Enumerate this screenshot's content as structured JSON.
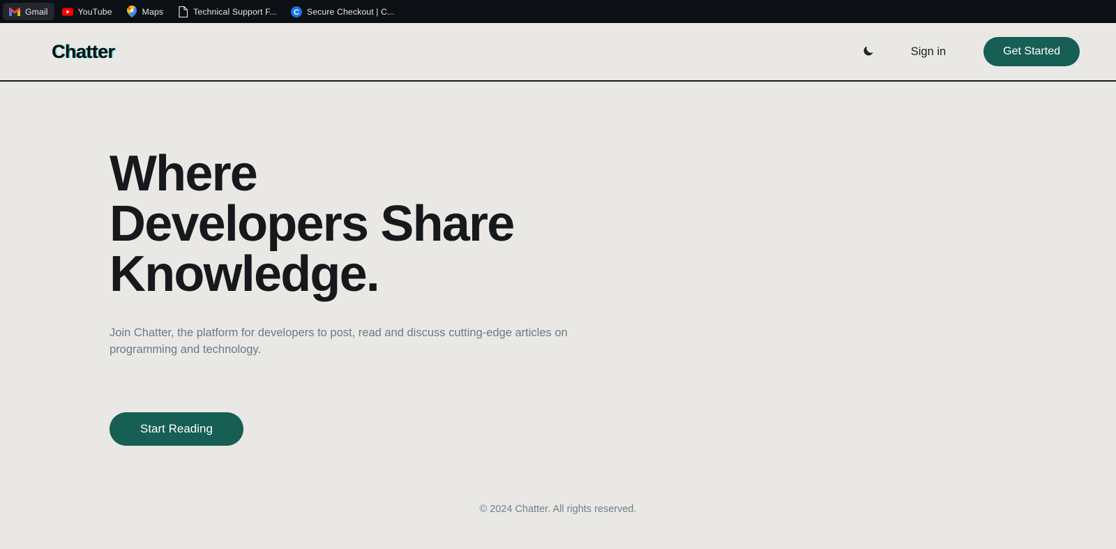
{
  "browser": {
    "bookmarks": [
      {
        "label": "Gmail",
        "icon": "gmail-icon",
        "active": true
      },
      {
        "label": "YouTube",
        "icon": "youtube-icon",
        "active": false
      },
      {
        "label": "Maps",
        "icon": "google-maps-icon",
        "active": false
      },
      {
        "label": "Technical Support F...",
        "icon": "document-icon",
        "active": false
      },
      {
        "label": "Secure Checkout | C...",
        "icon": "circle-c-icon",
        "active": false
      }
    ]
  },
  "header": {
    "logo": "Chatter",
    "theme_toggle_icon": "moon-icon",
    "sign_in_label": "Sign in",
    "get_started_label": "Get Started"
  },
  "hero": {
    "title_line1": "Where",
    "title_line2": "Developers Share",
    "title_line3": "Knowledge.",
    "subtitle": "Join Chatter, the platform for developers to post, read and discuss cutting-edge articles on programming and technology.",
    "cta_label": "Start Reading"
  },
  "footer": {
    "copyright": "© 2024 Chatter. All rights reserved."
  },
  "colors": {
    "page_background": "#e9e8e4",
    "bookmark_bar_background": "#0c0f14",
    "accent_teal": "#175e54",
    "heading": "#16191c",
    "muted_text": "#6b7b86",
    "logo_shadow_cyan": "#00bed2"
  }
}
